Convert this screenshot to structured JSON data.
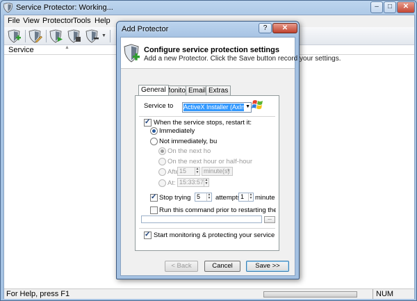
{
  "window": {
    "title": "Service Protector: Working...",
    "controls": {
      "minimize": "–",
      "maximize": "□",
      "close": "✕"
    }
  },
  "menu": [
    "File",
    "View",
    "Protector",
    "Tools",
    "Help"
  ],
  "list": {
    "column_service": "Service"
  },
  "statusbar": {
    "text": "For Help, press F1",
    "num": "NUM"
  },
  "dialog": {
    "title": "Add Protector",
    "help_button": "?",
    "close_button": "✕",
    "header_title": "Configure service protection settings",
    "header_subtitle": "Add a new Protector. Click the Save button record your settings.",
    "tabs": [
      "General",
      "Monitor",
      "Email",
      "Extras"
    ],
    "service_label": "Service to",
    "service_value": "ActiveX Installer (AxInstSV)",
    "restart_checkbox_label": "When the service stops, restart it:",
    "radio_immediately": "Immediately",
    "radio_not_immediately": "Not immediately, bu",
    "sub_on_next": "On the next ho",
    "sub_on_next_hour": "On the next hour or half-hour",
    "sub_after": "Afte",
    "after_value": "15",
    "after_unit": "minute(s)",
    "sub_at": "At:",
    "at_value": "15:33:57",
    "stop_trying_label": "Stop trying",
    "attempts_value": "5",
    "attempts_label": "attempts",
    "minutes_value": "1",
    "minutes_label": "minutes",
    "run_command_label": "Run this command prior to restarting the servic",
    "browse_label": "...",
    "start_monitoring_label": "Start monitoring & protecting your service",
    "back_button": "< Back",
    "cancel_button": "Cancel",
    "save_button": "Save >>"
  }
}
